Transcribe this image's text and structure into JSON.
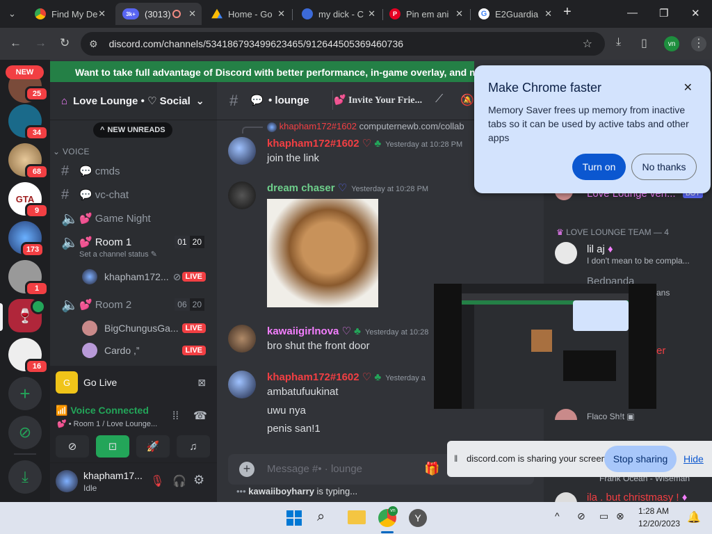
{
  "browser": {
    "tabs": [
      {
        "title": "Find My De",
        "favicon": "chrome"
      },
      {
        "title": "(3013)",
        "favicon": "discord",
        "active": true,
        "badge": "3k+"
      },
      {
        "title": "Home - Go",
        "favicon": "drive"
      },
      {
        "title": "my dick - C",
        "favicon": "person"
      },
      {
        "title": "Pin em ani",
        "favicon": "pinterest"
      },
      {
        "title": "E2Guardia",
        "favicon": "chrome"
      }
    ],
    "new_tab": "+",
    "url": "discord.com/channels/534186793499623465/912644505369460736",
    "profile_initials": "vn"
  },
  "promo": {
    "text": "Want to take full advantage of Discord with better performance, in-game overlay, and more? Get"
  },
  "rail": {
    "new_label": "NEW",
    "servers": [
      {
        "badge": "25",
        "color": "#7a4b3a"
      },
      {
        "badge": "34",
        "color": "#1a6a8a"
      },
      {
        "badge": "68",
        "color": "#c9a36a"
      },
      {
        "badge": "9",
        "color": "#a02020"
      },
      {
        "badge": "173",
        "color": "#3a5f9a"
      },
      {
        "badge": "1",
        "color": "#888"
      },
      {
        "badge": "",
        "color": "#b0263a"
      },
      {
        "badge": "16",
        "color": "#eeeeee"
      }
    ]
  },
  "server": {
    "name": "Love Lounge • ♡ Social",
    "new_unreads": "NEW UNREADS",
    "voice_category": "VOICE",
    "channels": [
      {
        "name": "cmds",
        "type": "text"
      },
      {
        "name": "vc-chat",
        "type": "text"
      },
      {
        "name": "Game Night",
        "type": "voice"
      },
      {
        "name": "Room 1",
        "type": "voice",
        "count": "01",
        "limit": "20",
        "status": "Set a channel status"
      },
      {
        "name": "Room 2",
        "type": "voice",
        "count": "06",
        "limit": "20"
      }
    ],
    "room1_users": [
      {
        "name": "khapham172...",
        "live": "LIVE"
      }
    ],
    "room2_users": [
      {
        "name": "BigChungusGa...",
        "live": "LIVE"
      },
      {
        "name": "Cardo ,”",
        "live": "LIVE"
      }
    ]
  },
  "golive": {
    "label": "Go Live"
  },
  "voice": {
    "status": "Voice Connected",
    "location": "• Room 1 / Love Lounge..."
  },
  "user": {
    "name": "khapham17...",
    "status": "Idle"
  },
  "chat": {
    "channel": "• lounge",
    "invite": "Invite Your Frie...",
    "reply_user": "khapham172#1602",
    "reply_text": "computernewb.com/collab",
    "messages": [
      {
        "author": "khapham172#1602",
        "time": "Yesterday at 10:28 PM",
        "color": "#f23f43",
        "lines": [
          "join the link"
        ]
      },
      {
        "author": "dream chaser",
        "time": "Yesterday at 10:28 PM",
        "color": "#6ecf8b",
        "lines": []
      },
      {
        "author": "kawaiigirlnova",
        "time": "Yesterday at 10:28",
        "color": "#f47fff",
        "lines": [
          "bro shut the front door"
        ]
      },
      {
        "author": "khapham172#1602",
        "time": "Yesterday a",
        "color": "#f23f43",
        "lines": [
          "ambatufuukinat",
          "uwu nya",
          "penis san!1"
        ]
      }
    ],
    "composer_placeholder": "Message #• · lounge",
    "typing": "kawaiiboyharry",
    "typing_suffix": " is typing..."
  },
  "members": {
    "top_entry": "Love Lounge veri...",
    "team_header": "LOVE LOUNGE TEAM — 4",
    "lilaj": "lil aj",
    "lilaj_status": "I don't mean to be compla...",
    "partial1": "Bedpanda",
    "partial2": "ans",
    "partial3": "er",
    "flaco": "Flaco Sh!t",
    "frank": "Frank Ocean - Wiseman",
    "ila": "ila . but christmasy !"
  },
  "popup": {
    "title": "Make Chrome faster",
    "body": "Memory Saver frees up memory from inactive tabs so it can be used by active tabs and other apps",
    "turn_on": "Turn on",
    "no_thanks": "No thanks"
  },
  "share": {
    "text": "discord.com is sharing your screen.",
    "stop": "Stop sharing",
    "hide": "Hide"
  },
  "taskbar": {
    "time": "1:28 AM",
    "date": "12/20/2023"
  }
}
